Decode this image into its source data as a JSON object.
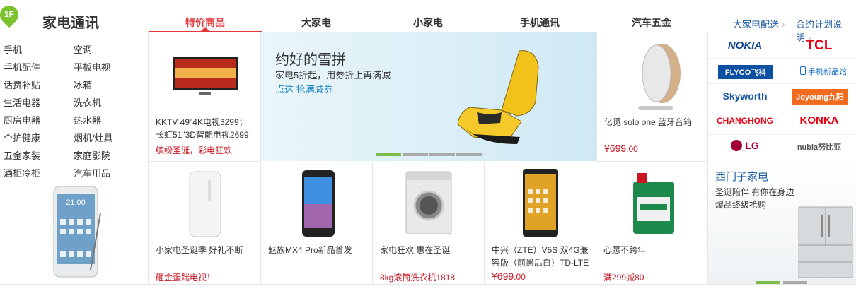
{
  "header": {
    "floor_badge": "1F",
    "title": "家电通讯",
    "tabs": [
      {
        "label": "特价商品"
      },
      {
        "label": "大家电"
      },
      {
        "label": "小家电"
      },
      {
        "label": "手机通讯"
      },
      {
        "label": "汽车五金"
      }
    ],
    "links": [
      {
        "label": "大家电配送"
      },
      {
        "label": "合约计划说明"
      }
    ]
  },
  "sidebar": {
    "categories": [
      {
        "label": "手机"
      },
      {
        "label": "空调"
      },
      {
        "label": "手机配件"
      },
      {
        "label": "平板电视"
      },
      {
        "label": "话费补贴"
      },
      {
        "label": "冰箱"
      },
      {
        "label": "生活电器"
      },
      {
        "label": "洗衣机"
      },
      {
        "label": "厨房电器"
      },
      {
        "label": "热水器"
      },
      {
        "label": "个护健康"
      },
      {
        "label": "烟机/灶具"
      },
      {
        "label": "五金家装"
      },
      {
        "label": "家庭影院"
      },
      {
        "label": "酒柜冷柜"
      },
      {
        "label": "汽车用品"
      }
    ]
  },
  "products_top": [
    {
      "name_line1": "KKTV 49\"4K电视3299；",
      "name_line2": "长虹51\"3D智能电视2699",
      "promo": "缤纷圣诞，彩电狂欢"
    },
    {
      "name_line1": "亿觅 solo one 蓝牙音箱",
      "price_symbol": "¥",
      "price_int": "699",
      "price_dec": ".00"
    }
  ],
  "banner": {
    "headline": "约好的雪拼",
    "subline": "家电5折起，用券折上再满减",
    "cta": "点这 抢满减券",
    "slides": 4,
    "active_slide": 0
  },
  "brands": [
    {
      "label": "NOKIA",
      "color": "#124191"
    },
    {
      "label": "TCL",
      "color": "#e60012"
    },
    {
      "label": "FLYCO飞科",
      "color": "#ffffff",
      "bg": "#0d4fa0"
    },
    {
      "label": "手机新品馆",
      "color": "#1a6fc9"
    },
    {
      "label": "Skyworth",
      "color": "#1a5aa5"
    },
    {
      "label": "Joyoung九阳",
      "color": "#ffffff",
      "bg": "#f06b1e"
    },
    {
      "label": "CHANGHONG",
      "color": "#e60012"
    },
    {
      "label": "KONKA",
      "color": "#e60012"
    },
    {
      "label": "LG",
      "color": "#a50034"
    },
    {
      "label": "nubia努比亚",
      "color": "#555555"
    }
  ],
  "products_bottom": [
    {
      "name_line1": "小家电圣诞季 好礼不断",
      "promo": "砸金蛋踹电视！"
    },
    {
      "name_line1": "魅族MX4 Pro新品首发"
    },
    {
      "name_line1": "家电狂欢 惠在圣诞",
      "promo": "8kg滚筒洗衣机1818"
    },
    {
      "name_line1": "中兴（ZTE）V5S 双4G兼",
      "name_line2": "容版（前黑后白）TD-LTE",
      "price_symbol": "¥",
      "price_int": "699",
      "price_dec": ".00"
    },
    {
      "name_line1": "心愿不跨年",
      "promo": "满299减80"
    }
  ],
  "xmen": {
    "title": "西门子家电",
    "line1": "圣诞陪伴 有你在身边",
    "line2": "爆品终级抢购"
  },
  "colors": {
    "accent_red": "#e4393c",
    "price_red": "#c81623",
    "link_blue": "#1a5aa5",
    "floor_green": "#7cc12e",
    "slide_active": "#7cbd4a"
  }
}
